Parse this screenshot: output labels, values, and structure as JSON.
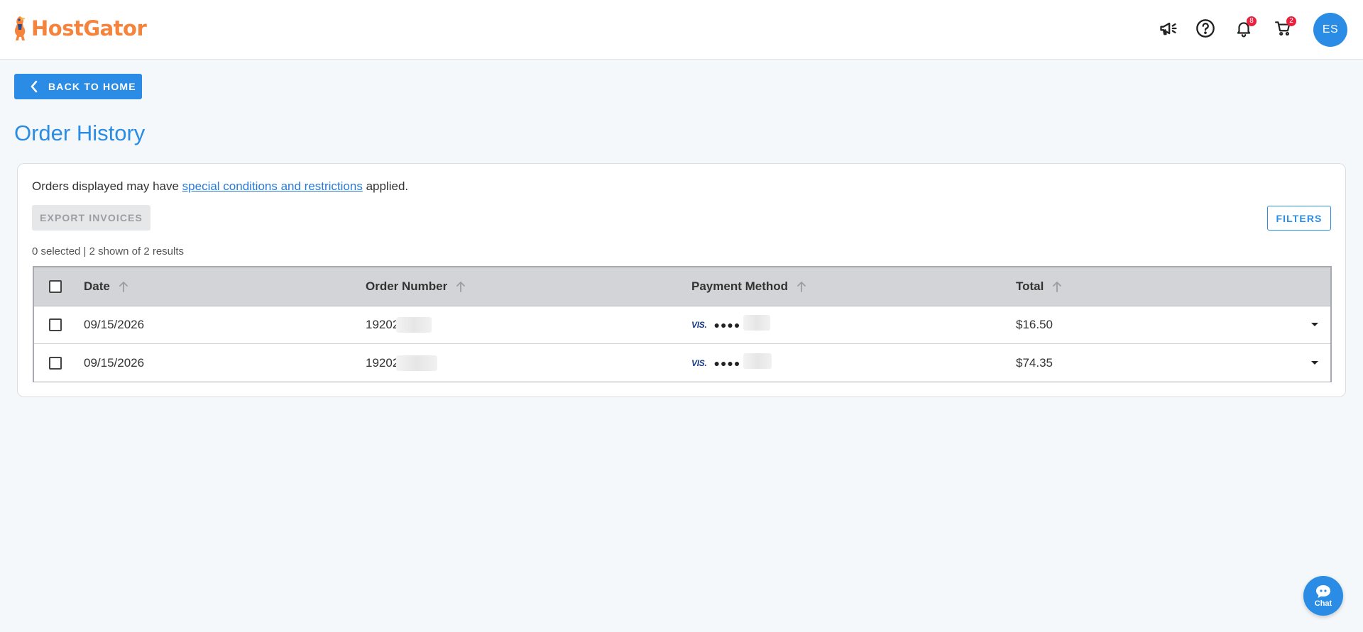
{
  "header": {
    "logo_text": "HostGator",
    "notifications_count": "8",
    "cart_count": "2",
    "avatar_initials": "ES"
  },
  "back_button_label": "BACK TO HOME",
  "page_title": "Order History",
  "notice": {
    "prefix": "Orders displayed may have ",
    "link": "special conditions and restrictions",
    "suffix": " applied."
  },
  "export_label": "EXPORT INVOICES",
  "filters_label": "FILTERS",
  "selection_info": "0 selected | 2 shown of 2 results",
  "table": {
    "headers": {
      "date": "Date",
      "order_number": "Order Number",
      "payment_method": "Payment Method",
      "total": "Total"
    },
    "rows": [
      {
        "date": "09/15/2026",
        "order_number": "19202",
        "card_brand": "VISA",
        "card_mask": "●●●●",
        "total": "$16.50"
      },
      {
        "date": "09/15/2026",
        "order_number": "19202",
        "card_brand": "VISA",
        "card_mask": "●●●●",
        "total": "$74.35"
      }
    ]
  },
  "chat_label": "Chat",
  "colors": {
    "brand_orange": "#f5833c",
    "primary_blue": "#2a8ce4",
    "badge_red": "#e8213f"
  }
}
